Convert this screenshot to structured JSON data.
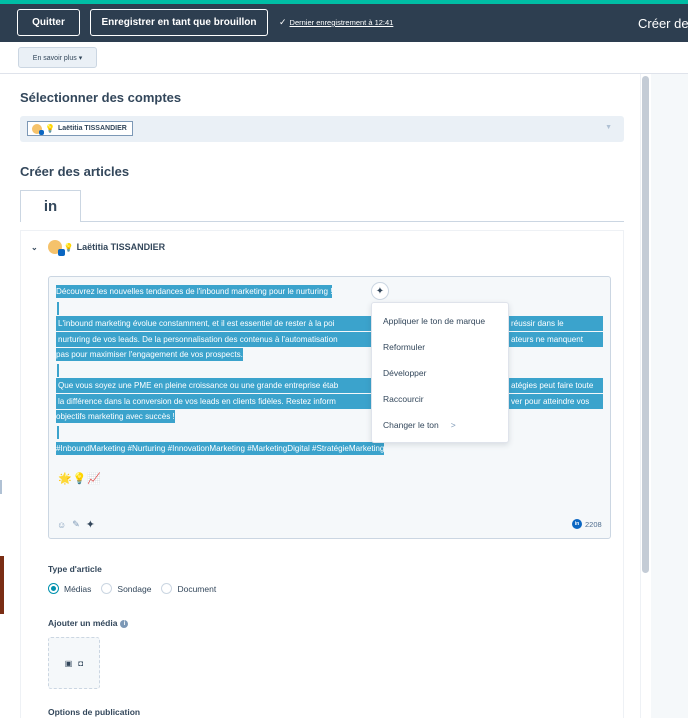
{
  "topbar": {
    "quit_label": "Quitter",
    "save_draft_label": "Enregistrer en tant que brouillon",
    "last_saved": "Dernier enregistrement à 12:41",
    "title": "Créer de"
  },
  "subbar": {
    "learn_more_label": "En savoir plus ▾"
  },
  "accounts": {
    "title": "Sélectionner des comptes",
    "selected_account": "Laëtitia TISSANDIER"
  },
  "articles": {
    "title": "Créer des articles",
    "tab_label": "in",
    "account_name": "Laëtitia TISSANDIER"
  },
  "editor": {
    "lines": [
      "Découvrez les nouvelles tendances de l'inbound marketing pour le nurturing !",
      "L'inbound marketing évolue constamment, et il est essentiel de rester à la poi",
      "nurturing de vos leads. De la personnalisation des contenus à l'automatisation",
      "pas pour maximiser l'engagement de vos prospects.",
      "Que vous soyez une PME en pleine croissance ou une grande entreprise étab",
      "la différence dans la conversion de vos leads en clients fidèles. Restez inform",
      "objectifs marketing avec succès !",
      "#InboundMarketing #Nurturing #InnovationMarketing #MarketingDigital #StratégieMarketing"
    ],
    "line_tails": [
      "réussir dans le",
      "ateurs ne manquent",
      "atégies peut faire toute",
      "ver pour atteindre vos"
    ],
    "emojis": "🌟💡📈",
    "char_count": "2208"
  },
  "ai_menu": {
    "items": [
      "Appliquer le ton de marque",
      "Reformuler",
      "Développer",
      "Raccourcir",
      "Changer le ton"
    ]
  },
  "post_type": {
    "label": "Type d'article",
    "options": [
      "Médias",
      "Sondage",
      "Document"
    ],
    "selected": "Médias"
  },
  "media": {
    "label": "Ajouter un média"
  },
  "publish_options": {
    "label": "Options de publication"
  },
  "icons": {
    "check": "check-icon",
    "sparkle": "sparkle-icon",
    "emoji": "emoji-icon",
    "attach": "attachment-icon",
    "image": "image-icon",
    "video": "video-icon",
    "info": "info-icon",
    "chevron": "chevron-down-icon",
    "linkedin": "linkedin-icon"
  },
  "colors": {
    "topbar_bg": "#2d3e50",
    "accent": "#00bda5",
    "selection": "#3ba3cc",
    "radio_on": "#0091ae",
    "linkedin": "#0a66c2"
  }
}
